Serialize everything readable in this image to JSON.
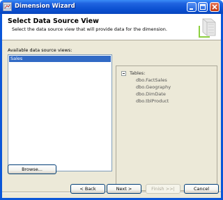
{
  "window": {
    "title": "Dimension Wizard"
  },
  "header": {
    "title": "Select Data Source View",
    "subtitle": "Select the data source view that will provide data for the dimension."
  },
  "data_source_views": {
    "label": "Available data source views:",
    "items": [
      "Sales"
    ],
    "selected": "Sales"
  },
  "tree": {
    "root_label": "Tables:",
    "expander_symbol": "−",
    "children": [
      "dbo.FactSales",
      "dbo.Geography",
      "dbo.DimDate",
      "dbo.tblProduct"
    ]
  },
  "buttons": {
    "browse": "Browse...",
    "back": "< Back",
    "next": "Next >",
    "finish": "Finish >>|",
    "cancel": "Cancel"
  },
  "colors": {
    "titlebar": "#0a56d8",
    "selection": "#316ac5",
    "dialog_bg": "#ece9d8"
  }
}
